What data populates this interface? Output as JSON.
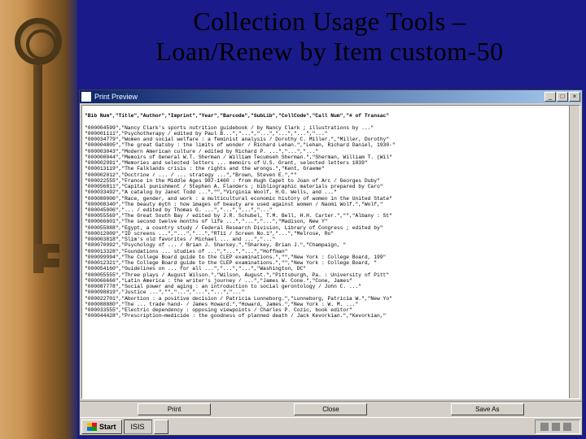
{
  "slide": {
    "title_line1": "Collection Usage Tools –",
    "title_line2": "Loan/Renew by Item custom-50"
  },
  "window": {
    "title": "Print Preview",
    "min_label": "_",
    "max_label": "□",
    "close_label": "×"
  },
  "report": {
    "headers": "\"Bib Num\",\"Title\",\"Author\",\"Imprint\",\"Year\",\"Barcode\",\"SubLib\",\"CollCode\",\"Call Num\",\"# of Transac\"",
    "rows": [
      "\"000004599\",\"Nancy Clark's sports nutrition guidebook / by Nancy Clark ; illustrations by ...\"",
      "\"000001111\",\"Psychotherapy / edited by Paul B...\",\"...\",\"...\",\"...\",\"...\",\"...\"",
      "\"000034779\",\"Women and social welfare : a feminist analysis / Dorothy C. Miller.\",\"Miller, Dorothy\"",
      "\"000004805\",\"The great Gatsby : the limits of wonder / Richard Lehan.\",\"Lehan, Richard Daniel, 1930-\"",
      "\"000003043\",\"Modern American culture / edited by Richard P. ...\",\"...\",\"...\"",
      "\"000000044\",\"Memoirs of General W.T. Sherman / William Tecumseh Sherman.\",\"Sherman, William T. (Wil\"",
      "\"000002991\",\"Memories and selected letters ... memoirs of U.S. Grant, selected letters 1839\"",
      "\"000013119\",\"The Falklands crisis : the rights and the wrongs.\",\"Kent, Graeme\"",
      "\"000002012\",\"Doctrine / ... / ... strategy ...\",\"Brown, Steven E.\",\"\"",
      "\"000022555\",\"France in the Middle Ages 987-1460 : from Hugh Capet to Joan of Arc / Georges Duby\"",
      "\"000056811\",\"Capital punishment / Stephen A. Flanders ; bibliographic materials prepared by Caro\"",
      "\"000033492\",\"A catalog by Janet Todd ...\",\"\",\"Virginia Woolf, H.G. Wells, and ...\"",
      "\"000080006\",\"Race, gender, and work : a multicultural economic history of women in the United State\"",
      "\"000008340\",\"The beauty myth : how images of beauty are used against women / Naomi Wolf.\",\"Wolf,\"",
      "\"000045006\",\"... / edited by Thomas G. ...\",\"...\",\"...\",\"...\"",
      "\"000055569\",\"The Great South Bay / edited by J.R. Schubel, T.M. Bell, H.H. Carter.\",\"\",\"Albany : St\"",
      "\"000066601\",\"The second twelve months of life ...\",\"...\",\"...\",\"Madison, New Y\"",
      "\"000055888\",\"Egypt, a country study / Federal Research Division, Library of Congress ; edited by\"",
      "\"000012009\",\"ID screens ...\",\"...\",\"...\",\"RT11 / Screen No.1\",\"...\",\"Melrose, Ro\"",
      "\"000003818\",\"Slim's old favorites / Michael ... and ...\",\"...\"",
      "\"000070992\",\"Psychology of ... / Brian J. Sharkey.\",\"Sharkey, Brian J.\",\"Champaign, \"",
      "\"000013328\",\"Foundations ... studies of ...\",\"...\",\"...\",\"Hoffman\"",
      "\"000099994\",\"The College Board guide to the CLEP examinations.\",\"\",\"New York : College Board, 199\"",
      "\"000012321\",\"The College Board guide to the CLEP examinations.\",\"\",\"New York : College Board, \"",
      "\"000054160\",\"Guidelines on ... for all ...\",\"...\",\"...\",\"Washington, DC\"",
      "\"000055555\",\"Three plays / August Wilson.\",\"Wilson, August.\",\"Pittsburgh, Pa. : University of Pitt\"",
      "\"000066666\",\"Latin America : the writer's journey / ...\",\"James W. Cone.\",\"Cone, James\"",
      "\"000087778\",\"Social power and aging : an introduction to social gerontology / John C. ...\"",
      "\"000098819\",\"Justice ...\",\"\",\"...\",\"...\",\"...\",\"...\"",
      "\"000022701\",\"Abortion : a positive decision / Patricia Lunneborg.\",\"Lunneborg, Patricia W.\",\"New Yo\"",
      "\"000088880\",\"The ... trade hand- / James Howard.\",\"Howard, James.\",\"New York : W. M. ...\"",
      "\"000033555\",\"Electric dependency : opposing viewpoints / Charles P. Cozic, book editor\"",
      "\"000044428\",\"Prescription—medicide : the goodness of planned death / Jack Kevorkian.\",\"Kevorkian,\""
    ]
  },
  "buttons": {
    "print": "Print",
    "close": "Close",
    "save": "Save As"
  },
  "taskbar": {
    "start": "Start",
    "task1": "ISIS",
    "task2": "",
    "time": ""
  }
}
